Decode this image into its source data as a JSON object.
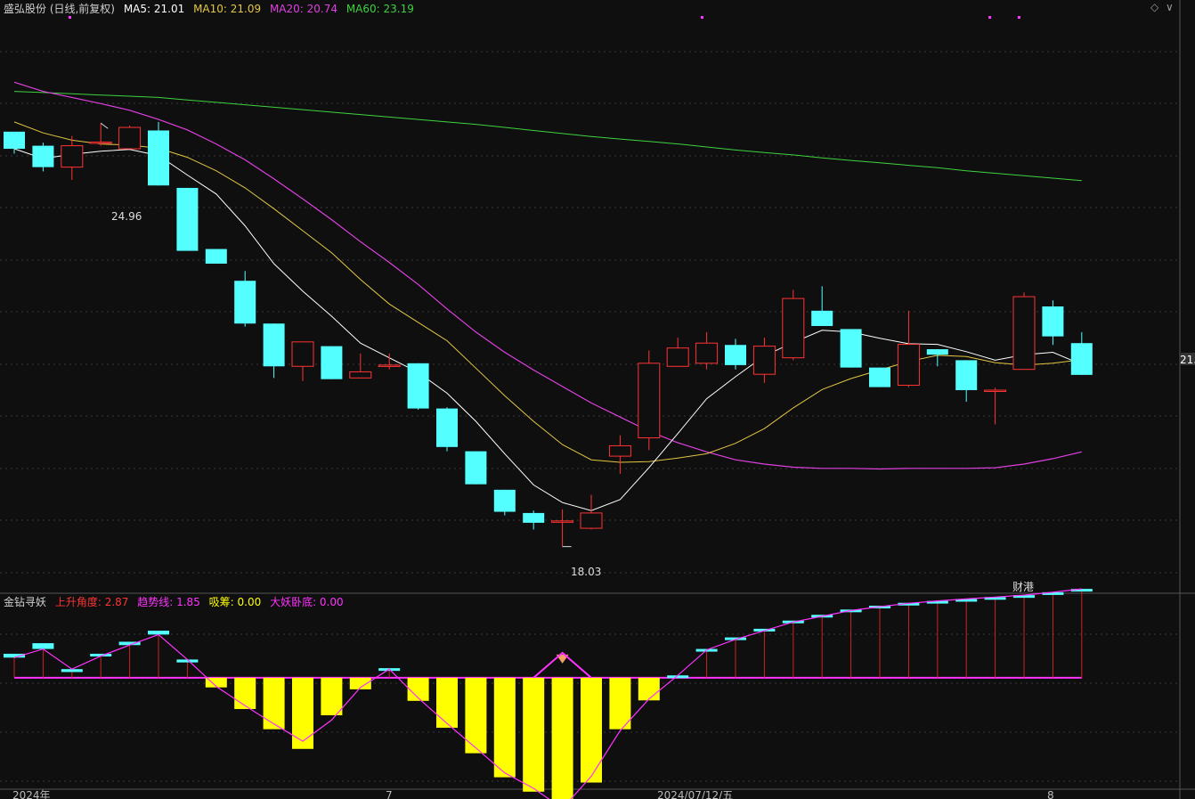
{
  "header": {
    "title": "盛弘股份 (日线,前复权)",
    "ma5": "MA5: 21.01",
    "ma10": "MA10: 21.09",
    "ma20": "MA20: 20.74",
    "ma60": "MA60: 23.19",
    "controls": [
      "◇",
      "∨"
    ]
  },
  "indicator_header": {
    "name": "金钻寻妖",
    "rise_angle": "上升角度: 2.87",
    "trend_line": "趋势线: 1.85",
    "absorb": "吸筹: 0.00",
    "lying": "大妖卧底: 0.00"
  },
  "annotations": {
    "high": "24.96",
    "low": "18.03",
    "news_tag": "财港",
    "price_edge": "21."
  },
  "x_axis": {
    "labels": [
      "2024年",
      "7",
      "2024/07/12/五",
      "8"
    ]
  },
  "colors": {
    "background": "#0f0f10",
    "up_candle": "#ff3333",
    "down_candle": "#54ffff",
    "ma5": "#ffffff",
    "ma10": "#e3c642",
    "ma20": "#e040e0",
    "ma60": "#3fd23f",
    "ind_positive": "#54ffff",
    "ind_negative": "#ffff00",
    "ind_line": "#ff33ff",
    "ind_stem": "#cc2222",
    "grid": "#3a3a3a",
    "pink_marker": "#ff33ff"
  },
  "chart_data": [
    {
      "type": "candlestick",
      "title": "盛弘股份 (日线,前复权)",
      "ylim": [
        17.5,
        26.8
      ],
      "candles": [
        {
          "o": 24.82,
          "c": 24.54,
          "h": 24.82,
          "l": 24.46
        },
        {
          "o": 24.59,
          "c": 24.24,
          "h": 24.64,
          "l": 24.17
        },
        {
          "o": 24.24,
          "c": 24.59,
          "h": 24.75,
          "l": 24.03
        },
        {
          "o": 24.63,
          "c": 24.65,
          "h": 24.96,
          "l": 24.59
        },
        {
          "o": 24.54,
          "c": 24.89,
          "h": 24.92,
          "l": 24.54
        },
        {
          "o": 24.84,
          "c": 23.94,
          "h": 24.98,
          "l": 23.94
        },
        {
          "o": 23.9,
          "c": 22.87,
          "h": 23.9,
          "l": 22.87
        },
        {
          "o": 22.9,
          "c": 22.66,
          "h": 22.9,
          "l": 22.66
        },
        {
          "o": 22.38,
          "c": 21.68,
          "h": 22.54,
          "l": 21.63
        },
        {
          "o": 21.68,
          "c": 20.98,
          "h": 21.68,
          "l": 20.79
        },
        {
          "o": 20.98,
          "c": 21.38,
          "h": 21.38,
          "l": 20.74
        },
        {
          "o": 21.31,
          "c": 20.77,
          "h": 21.31,
          "l": 20.77
        },
        {
          "o": 20.79,
          "c": 20.89,
          "h": 21.19,
          "l": 20.79
        },
        {
          "o": 20.98,
          "c": 21.0,
          "h": 21.19,
          "l": 20.93
        },
        {
          "o": 21.03,
          "c": 20.29,
          "h": 21.03,
          "l": 20.27
        },
        {
          "o": 20.29,
          "c": 19.66,
          "h": 20.31,
          "l": 19.59
        },
        {
          "o": 19.59,
          "c": 19.05,
          "h": 19.59,
          "l": 19.05
        },
        {
          "o": 18.96,
          "c": 18.6,
          "h": 18.96,
          "l": 18.54
        },
        {
          "o": 18.58,
          "c": 18.42,
          "h": 18.62,
          "l": 18.31
        },
        {
          "o": 18.44,
          "c": 18.45,
          "h": 18.64,
          "l": 18.03
        },
        {
          "o": 18.33,
          "c": 18.58,
          "h": 18.88,
          "l": 18.31
        },
        {
          "o": 19.51,
          "c": 19.68,
          "h": 19.85,
          "l": 19.22
        },
        {
          "o": 19.81,
          "c": 21.03,
          "h": 21.24,
          "l": 19.61
        },
        {
          "o": 20.98,
          "c": 21.28,
          "h": 21.45,
          "l": 20.98
        },
        {
          "o": 21.03,
          "c": 21.36,
          "h": 21.54,
          "l": 20.93
        },
        {
          "o": 21.33,
          "c": 21.0,
          "h": 21.43,
          "l": 20.93
        },
        {
          "o": 20.85,
          "c": 21.31,
          "h": 21.45,
          "l": 20.71
        },
        {
          "o": 21.12,
          "c": 22.09,
          "h": 22.23,
          "l": 21.08
        },
        {
          "o": 21.89,
          "c": 21.64,
          "h": 22.29,
          "l": 21.64
        },
        {
          "o": 21.59,
          "c": 20.96,
          "h": 21.59,
          "l": 20.96
        },
        {
          "o": 20.96,
          "c": 20.64,
          "h": 20.96,
          "l": 20.64
        },
        {
          "o": 20.67,
          "c": 21.34,
          "h": 21.89,
          "l": 20.64
        },
        {
          "o": 21.26,
          "c": 21.17,
          "h": 21.26,
          "l": 20.98
        },
        {
          "o": 21.08,
          "c": 20.59,
          "h": 21.08,
          "l": 20.4
        },
        {
          "o": 20.59,
          "c": 20.59,
          "h": 20.63,
          "l": 20.03
        },
        {
          "o": 20.93,
          "c": 22.12,
          "h": 22.19,
          "l": 20.93
        },
        {
          "o": 21.96,
          "c": 21.47,
          "h": 22.06,
          "l": 21.33
        },
        {
          "o": 21.36,
          "c": 20.84,
          "h": 21.54,
          "l": 20.84
        }
      ],
      "ma5": [
        24.54,
        24.38,
        24.45,
        24.5,
        24.53,
        24.43,
        24.11,
        23.8,
        23.28,
        22.66,
        22.21,
        21.8,
        21.36,
        21.12,
        20.88,
        20.54,
        20.08,
        19.55,
        19.04,
        18.75,
        18.62,
        18.8,
        19.32,
        19.88,
        20.45,
        20.81,
        21.15,
        21.37,
        21.57,
        21.54,
        21.44,
        21.35,
        21.34,
        21.22,
        21.08,
        21.17,
        21.21,
        21.01
      ],
      "ma10": [
        24.98,
        24.8,
        24.68,
        24.62,
        24.6,
        24.55,
        24.4,
        24.18,
        23.9,
        23.56,
        23.2,
        22.84,
        22.4,
        22.0,
        21.7,
        21.4,
        20.95,
        20.5,
        20.08,
        19.7,
        19.45,
        19.41,
        19.42,
        19.48,
        19.55,
        19.72,
        19.96,
        20.3,
        20.6,
        20.78,
        20.92,
        21.06,
        21.16,
        21.14,
        21.04,
        21.0,
        21.03,
        21.09
      ],
      "ma20": [
        25.63,
        25.48,
        25.38,
        25.28,
        25.17,
        25.02,
        24.85,
        24.62,
        24.36,
        24.05,
        23.72,
        23.38,
        23.02,
        22.68,
        22.32,
        21.92,
        21.54,
        21.21,
        20.92,
        20.65,
        20.38,
        20.15,
        19.92,
        19.73,
        19.58,
        19.45,
        19.38,
        19.33,
        19.31,
        19.31,
        19.3,
        19.31,
        19.31,
        19.31,
        19.32,
        19.38,
        19.47,
        19.58
      ],
      "ma60": [
        25.48,
        25.46,
        25.44,
        25.42,
        25.4,
        25.38,
        25.34,
        25.3,
        25.26,
        25.22,
        25.18,
        25.14,
        25.1,
        25.06,
        25.02,
        24.98,
        24.94,
        24.89,
        24.84,
        24.79,
        24.74,
        24.7,
        24.66,
        24.62,
        24.57,
        24.52,
        24.48,
        24.44,
        24.39,
        24.35,
        24.31,
        24.27,
        24.23,
        24.18,
        24.14,
        24.1,
        24.06,
        24.02
      ]
    },
    {
      "type": "bar",
      "title": "金钻寻妖",
      "ylim": [
        -2.3,
        1.5
      ],
      "series": [
        {
          "name": "上升角度",
          "values": [
            0.5,
            0.72,
            0.12,
            0.5,
            0.75,
            0.98,
            0.32,
            -0.2,
            -0.65,
            -1.07,
            -1.48,
            -0.78,
            -0.24,
            0.2,
            -0.48,
            -1.04,
            -1.57,
            -2.07,
            -2.37,
            -2.8,
            -2.18,
            -1.07,
            -0.47,
            0.03,
            0.6,
            0.84,
            1.02,
            1.19,
            1.31,
            1.42,
            1.5,
            1.56,
            1.59,
            1.63,
            1.67,
            1.72,
            1.76,
            1.82
          ]
        },
        {
          "name": "趋势线",
          "values": [
            0.42,
            0.6,
            0.18,
            0.45,
            0.68,
            0.9,
            0.38,
            -0.18,
            -0.58,
            -0.96,
            -1.32,
            -0.88,
            -0.2,
            0.18,
            -0.42,
            -0.95,
            -1.46,
            -1.98,
            -2.3,
            -2.72,
            -2.05,
            -1.1,
            -0.44,
            0.05,
            0.58,
            0.8,
            0.98,
            1.16,
            1.28,
            1.4,
            1.48,
            1.55,
            1.6,
            1.64,
            1.68,
            1.72,
            1.78,
            1.85
          ]
        },
        {
          "name": "吸筹",
          "values": [
            0,
            0,
            0,
            0,
            0,
            0,
            0,
            0,
            0,
            0,
            0,
            0,
            0,
            0,
            0,
            0,
            0,
            0,
            0,
            0,
            0,
            0,
            0,
            0,
            0,
            0,
            0,
            0,
            0,
            0,
            0,
            0,
            0,
            0,
            0,
            0,
            0,
            0
          ]
        },
        {
          "name": "大妖卧底",
          "values": [
            0,
            0,
            0,
            0,
            0,
            0,
            0,
            0,
            0,
            0,
            0,
            0,
            0,
            0,
            0,
            0,
            0,
            0,
            0,
            0,
            0,
            0,
            0,
            0,
            0,
            0,
            0,
            0,
            0,
            0,
            0,
            0,
            0,
            0,
            0,
            0,
            0,
            0
          ]
        }
      ],
      "rise_angle_current": 2.87,
      "trend_line_current": 1.85
    }
  ]
}
